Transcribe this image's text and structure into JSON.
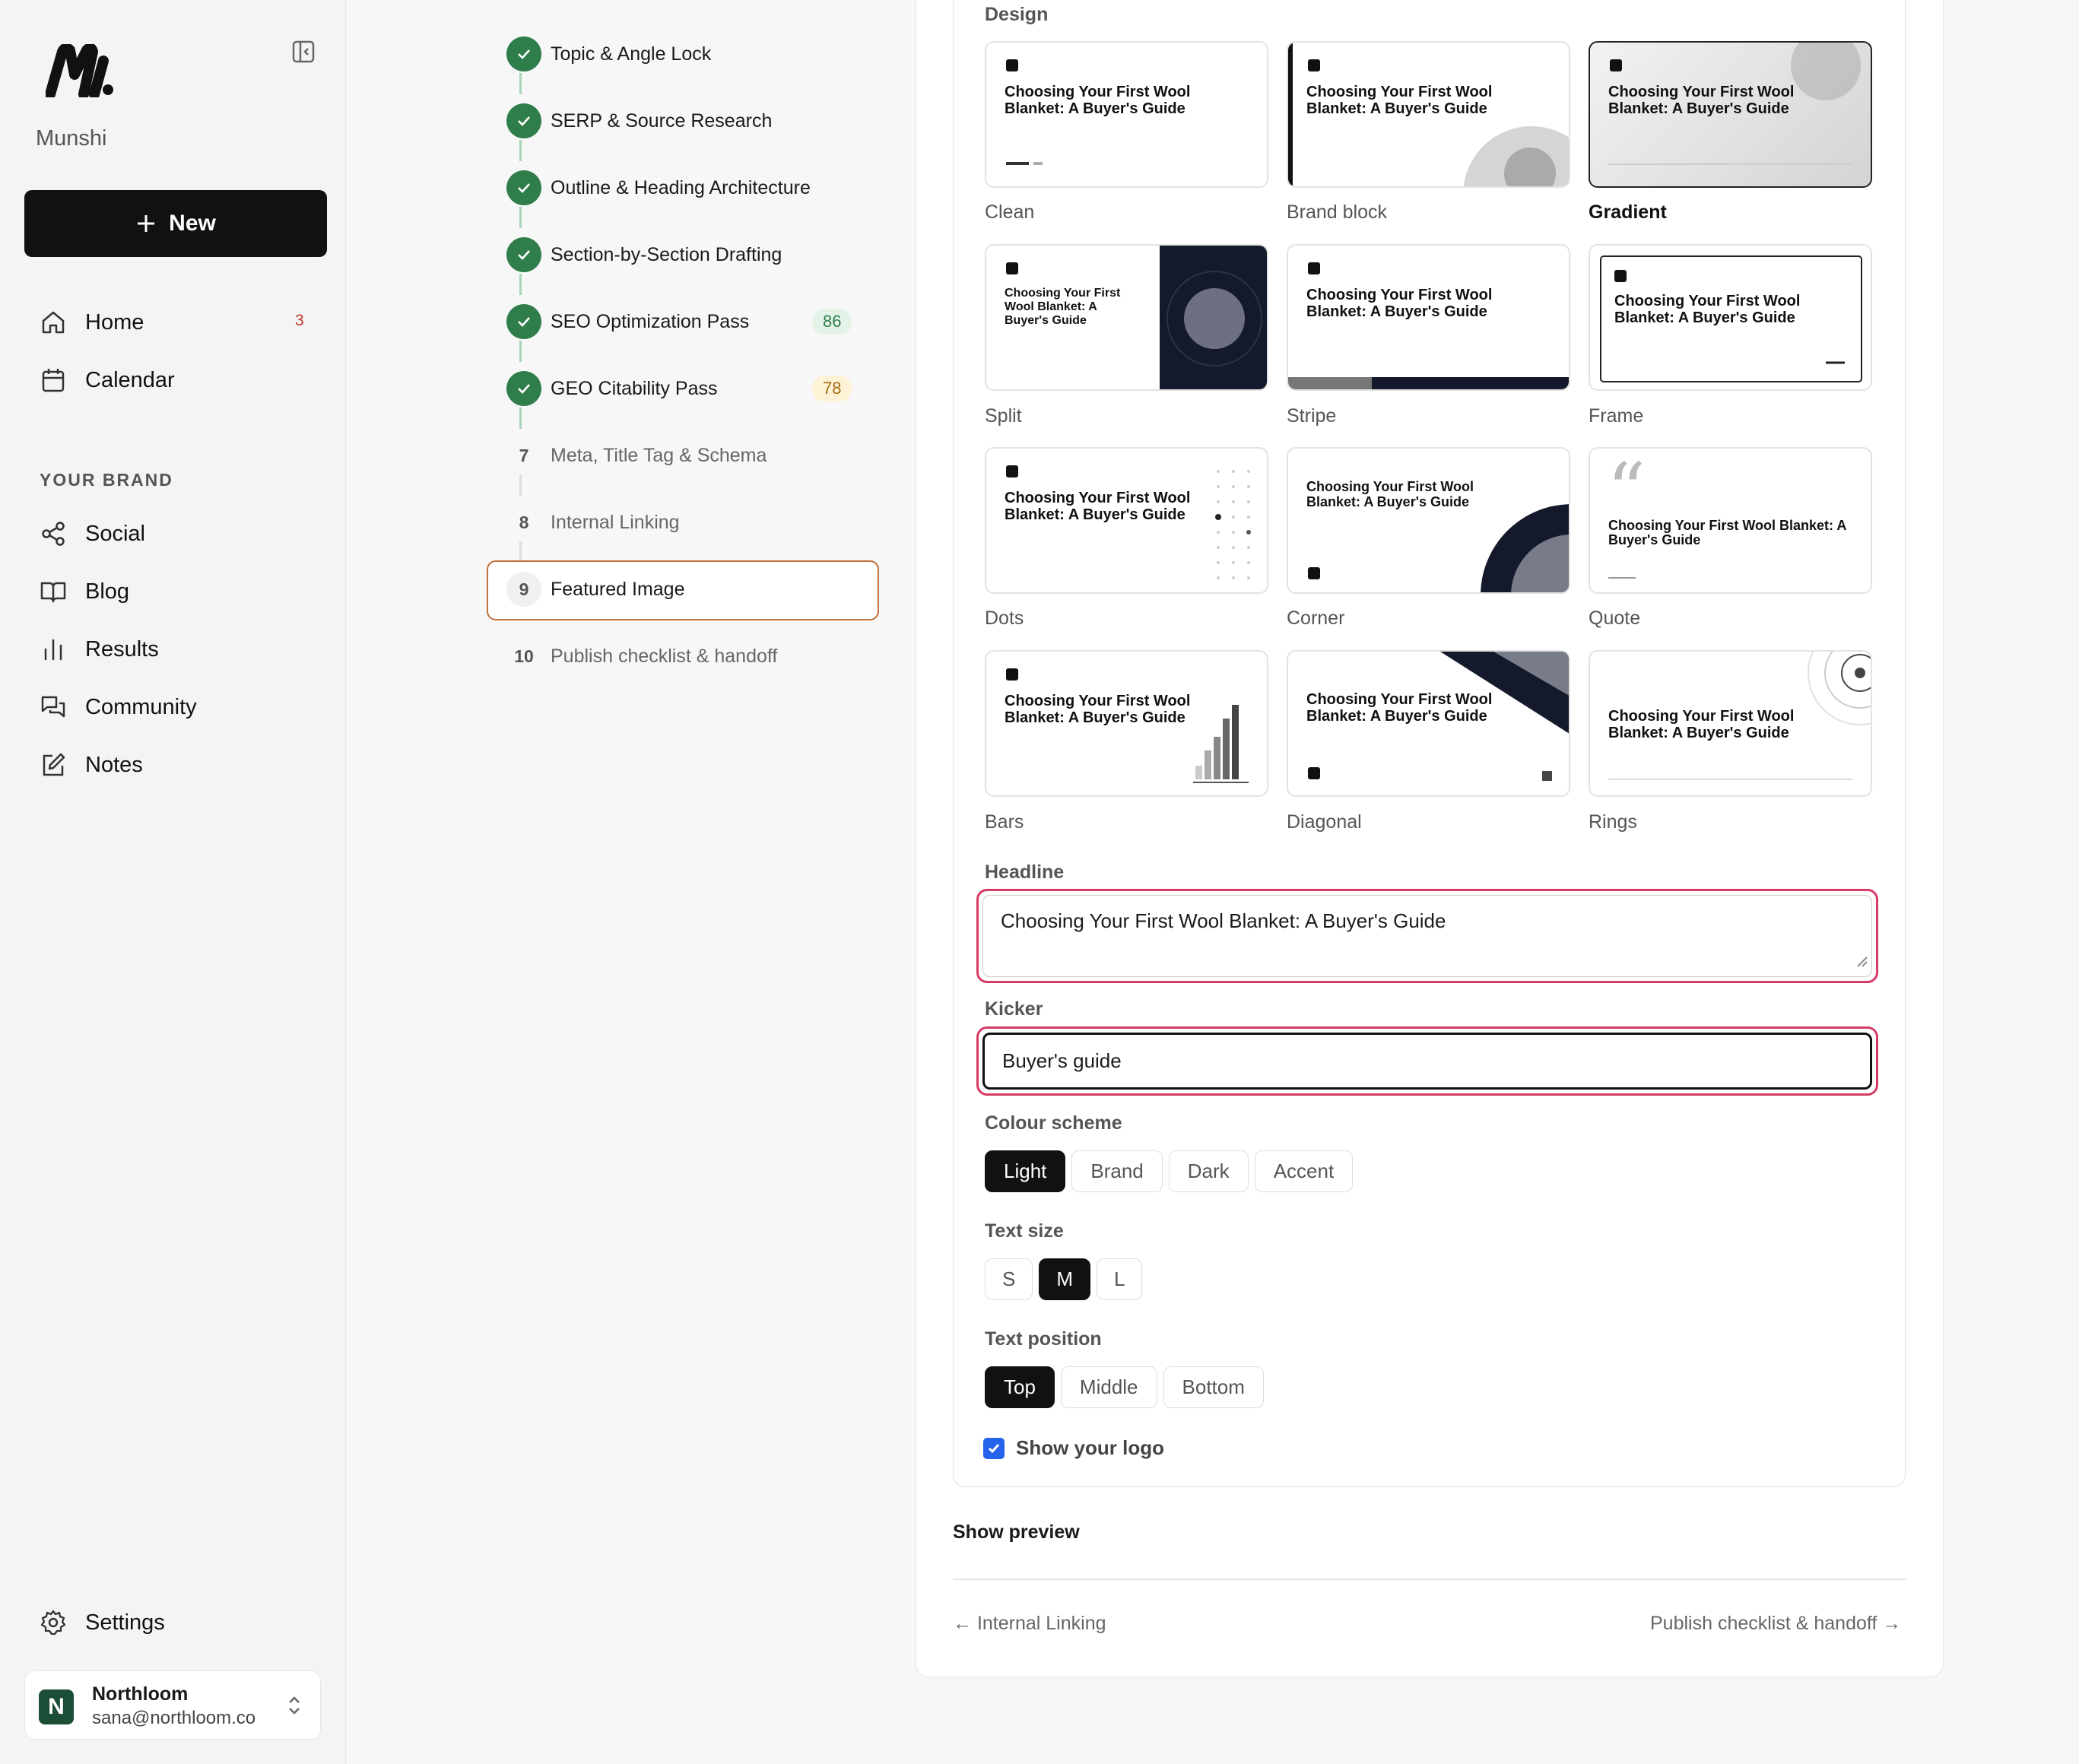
{
  "app": {
    "name": "Munshi",
    "new_label": "New"
  },
  "nav": {
    "items": [
      {
        "label": "Home",
        "icon": "home-icon",
        "badge": "3"
      },
      {
        "label": "Calendar",
        "icon": "calendar-icon"
      }
    ],
    "section_label": "YOUR BRAND",
    "brand_items": [
      {
        "label": "Social",
        "icon": "share-icon"
      },
      {
        "label": "Blog",
        "icon": "book-icon"
      },
      {
        "label": "Results",
        "icon": "bar-chart-icon"
      },
      {
        "label": "Community",
        "icon": "chat-icon"
      },
      {
        "label": "Notes",
        "icon": "edit-icon"
      }
    ],
    "settings_label": "Settings"
  },
  "account": {
    "initial": "N",
    "name": "Northloom",
    "email": "sana@northloom.co"
  },
  "steps": [
    {
      "label": "Topic & Angle Lock",
      "status": "done"
    },
    {
      "label": "SERP & Source Research",
      "status": "done"
    },
    {
      "label": "Outline & Heading Architecture",
      "status": "done"
    },
    {
      "label": "Section-by-Section Drafting",
      "status": "done"
    },
    {
      "label": "SEO Optimization Pass",
      "status": "done",
      "score": "86"
    },
    {
      "label": "GEO Citability Pass",
      "status": "done",
      "score": "78"
    },
    {
      "num": "7",
      "label": "Meta, Title Tag & Schema",
      "status": "todo"
    },
    {
      "num": "8",
      "label": "Internal Linking",
      "status": "todo"
    },
    {
      "num": "9",
      "label": "Featured Image",
      "status": "active"
    },
    {
      "num": "10",
      "label": "Publish checklist & handoff",
      "status": "todo"
    }
  ],
  "design": {
    "label": "Design",
    "tile_title": "Choosing Your First Wool Blanket: A Buyer's Guide",
    "selected": "Gradient",
    "templates": [
      "Clean",
      "Brand block",
      "Gradient",
      "Split",
      "Stripe",
      "Frame",
      "Dots",
      "Corner",
      "Quote",
      "Bars",
      "Diagonal",
      "Rings"
    ]
  },
  "headline": {
    "label": "Headline",
    "value": "Choosing Your First Wool Blanket: A Buyer's Guide"
  },
  "kicker": {
    "label": "Kicker",
    "value": "Buyer's guide"
  },
  "colour_scheme": {
    "label": "Colour scheme",
    "options": [
      "Light",
      "Brand",
      "Dark",
      "Accent"
    ],
    "selected": "Light"
  },
  "text_size": {
    "label": "Text size",
    "options": [
      "S",
      "M",
      "L"
    ],
    "selected": "M"
  },
  "text_position": {
    "label": "Text position",
    "options": [
      "Top",
      "Middle",
      "Bottom"
    ],
    "selected": "Top"
  },
  "show_logo": {
    "label": "Show your logo",
    "checked": true
  },
  "show_preview_label": "Show preview",
  "pager": {
    "prev": "← Internal Linking",
    "next": "Publish checklist & handoff →"
  },
  "colors": {
    "success": "#2e7d4a",
    "active_border": "#c07038",
    "focus_ring": "#d63b66",
    "checkbox": "#2563eb"
  }
}
